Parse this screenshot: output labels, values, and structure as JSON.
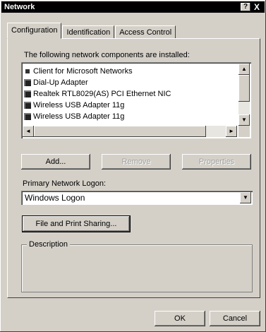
{
  "window": {
    "title": "Network",
    "help_label": "?",
    "close_label": "X"
  },
  "tabs": [
    {
      "label": "Configuration"
    },
    {
      "label": "Identification"
    },
    {
      "label": "Access Control"
    }
  ],
  "components": {
    "caption": "The following network components are installed:",
    "items": [
      {
        "label": "Client for Microsoft Networks",
        "icon": "client-icon"
      },
      {
        "label": "Dial-Up Adapter",
        "icon": "adapter-icon"
      },
      {
        "label": "Realtek RTL8029(AS) PCI Ethernet NIC",
        "icon": "adapter-icon"
      },
      {
        "label": "Wireless USB Adapter 11g",
        "icon": "adapter-icon"
      },
      {
        "label": "Wireless USB Adapter 11g",
        "icon": "adapter-icon"
      }
    ],
    "scroll_up": "▲",
    "scroll_down": "▼",
    "scroll_left": "◄",
    "scroll_right": "►"
  },
  "buttons": {
    "add": "Add...",
    "remove": "Remove",
    "properties": "Properties",
    "file_print_sharing": "File and Print Sharing...",
    "ok": "OK",
    "cancel": "Cancel"
  },
  "logon": {
    "label": "Primary Network Logon:",
    "value": "Windows Logon",
    "arrow": "▼"
  },
  "description": {
    "legend": "Description"
  }
}
